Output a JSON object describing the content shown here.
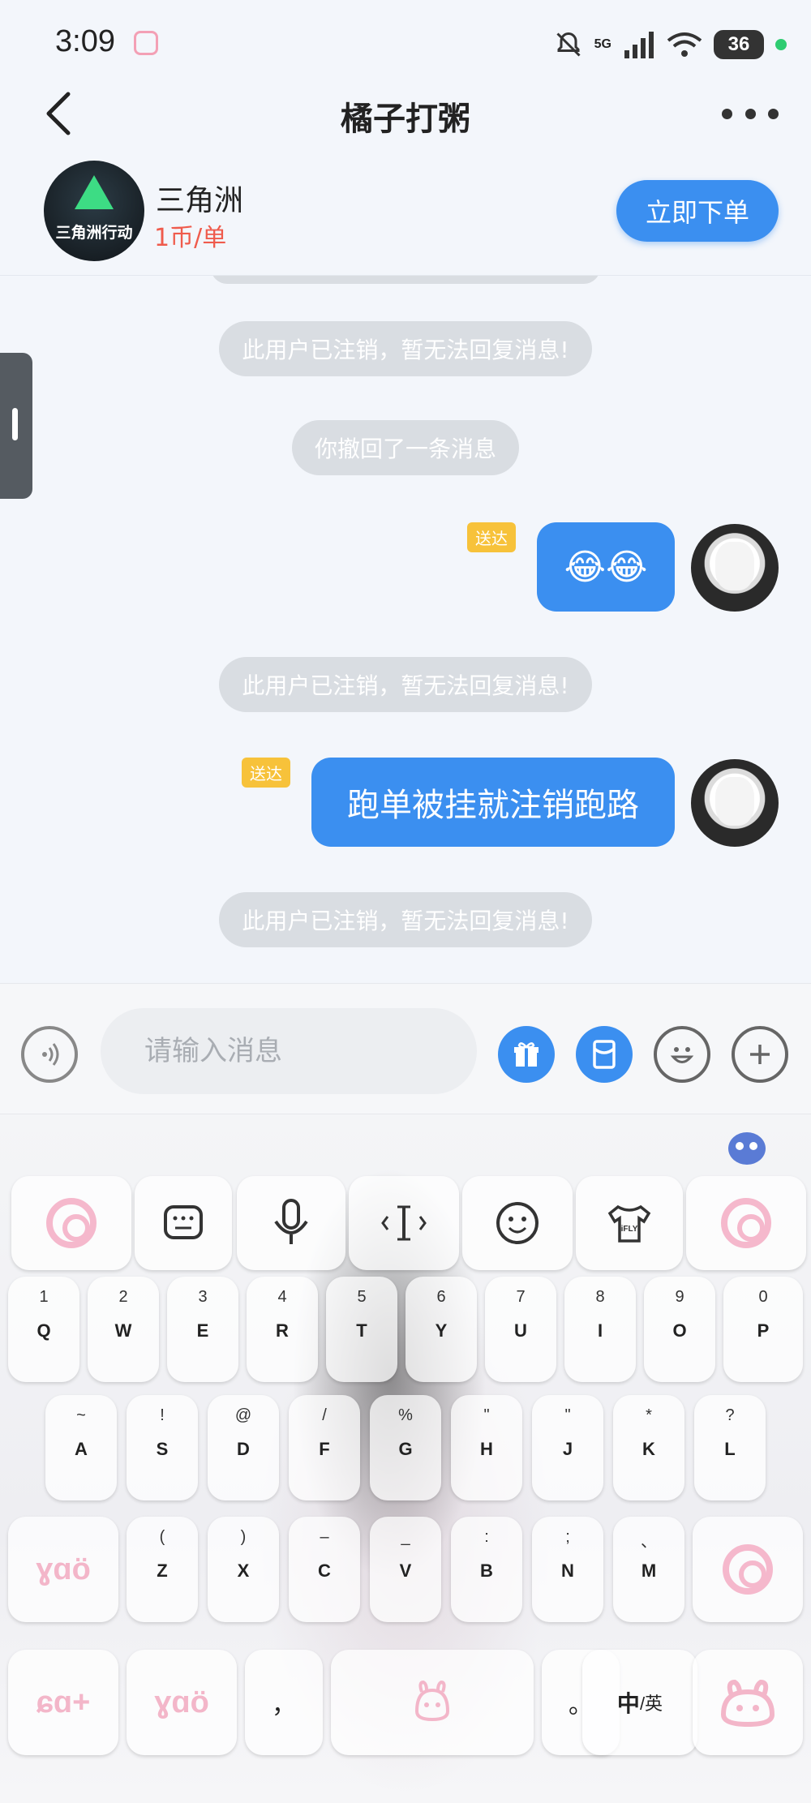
{
  "status_bar": {
    "time": "3:09",
    "network": "5G",
    "battery": "36"
  },
  "header": {
    "title": "橘子打粥"
  },
  "game": {
    "logo_text": "三角洲行动",
    "name": "三角洲",
    "price": "1币/单",
    "order_button": "立即下单"
  },
  "messages": [
    {
      "type": "system",
      "text": "此用户已注销，暂无法回复消息!"
    },
    {
      "type": "system",
      "text": "你撤回了一条消息"
    },
    {
      "type": "outgoing",
      "text": "😂😂",
      "tag": "送达"
    },
    {
      "type": "system",
      "text": "此用户已注销，暂无法回复消息!"
    },
    {
      "type": "outgoing",
      "text": "跑单被挂就注销跑路",
      "tag": "送达"
    },
    {
      "type": "system",
      "text": "此用户已注销，暂无法回复消息!"
    }
  ],
  "input": {
    "placeholder": "请输入消息"
  },
  "keyboard": {
    "toolbar": [
      {
        "icon": "keyboard-icon",
        "glyph": "⌨"
      },
      {
        "icon": "microphone-icon",
        "glyph": "🎙"
      },
      {
        "icon": "text-cursor-icon",
        "glyph": "‹I›"
      },
      {
        "icon": "smiley-icon",
        "glyph": "☺"
      },
      {
        "icon": "tshirt-icon",
        "glyph": "iFLY"
      }
    ],
    "row1": [
      {
        "sub": "1",
        "main": "Q"
      },
      {
        "sub": "2",
        "main": "W"
      },
      {
        "sub": "3",
        "main": "E"
      },
      {
        "sub": "4",
        "main": "R"
      },
      {
        "sub": "5",
        "main": "T"
      },
      {
        "sub": "6",
        "main": "Y"
      },
      {
        "sub": "7",
        "main": "U"
      },
      {
        "sub": "8",
        "main": "I"
      },
      {
        "sub": "9",
        "main": "O"
      },
      {
        "sub": "0",
        "main": "P"
      }
    ],
    "row2": [
      {
        "sub": "~",
        "main": "A"
      },
      {
        "sub": "!",
        "main": "S"
      },
      {
        "sub": "@",
        "main": "D"
      },
      {
        "sub": "/",
        "main": "F"
      },
      {
        "sub": "%",
        "main": "G"
      },
      {
        "sub": "\"",
        "main": "H"
      },
      {
        "sub": "\"",
        "main": "J"
      },
      {
        "sub": "*",
        "main": "K"
      },
      {
        "sub": "?",
        "main": "L"
      }
    ],
    "row3": [
      {
        "sub": "(",
        "main": "Z"
      },
      {
        "sub": ")",
        "main": "X"
      },
      {
        "sub": "–",
        "main": "C"
      },
      {
        "sub": "_",
        "main": "V"
      },
      {
        "sub": ":",
        "main": "B"
      },
      {
        "sub": ";",
        "main": "N"
      },
      {
        "sub": "、",
        "main": "M"
      }
    ],
    "row3_left_deco": "ɣɑӧ",
    "bottom": {
      "deco1": "ɕɑ+",
      "deco2": "ɣɑӧ",
      "comma": "，",
      "period": "。",
      "lang_main": "中",
      "lang_sub": "/英"
    }
  },
  "colors": {
    "accent": "#3b8ff0",
    "price": "#ef5b4c",
    "tag": "#f7c23a",
    "system_pill": "#d9dde2"
  }
}
